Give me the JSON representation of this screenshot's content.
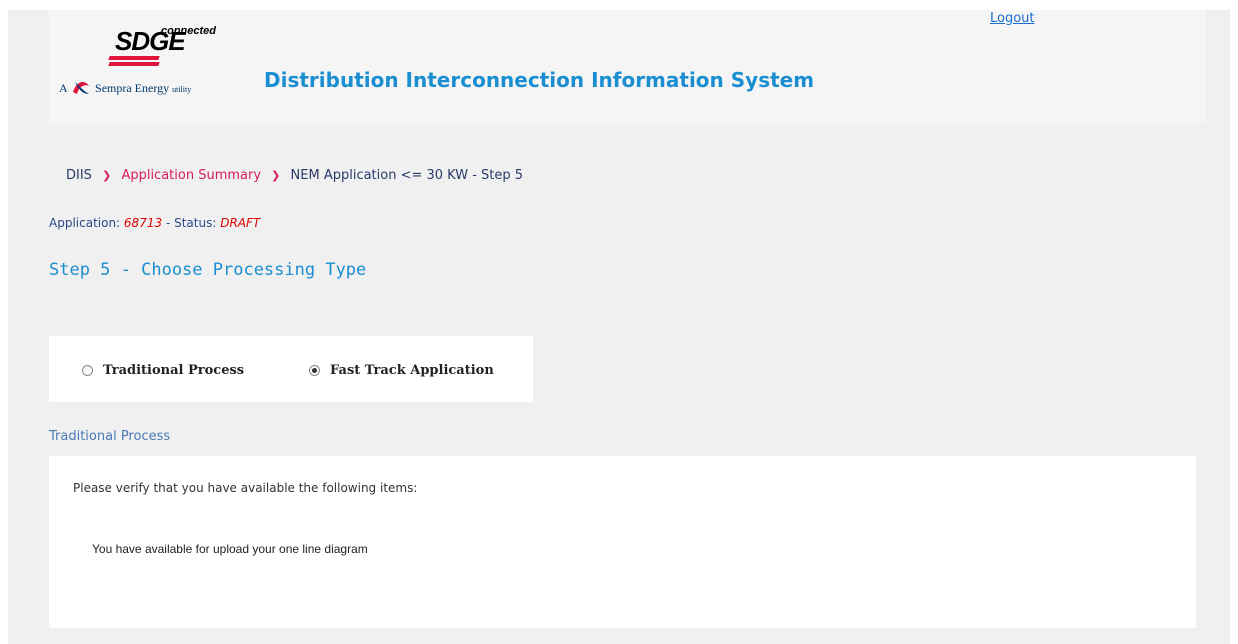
{
  "header": {
    "logo_sdge": "SDGE",
    "logo_connected": "connected",
    "logo_tagline_prefix": "A",
    "logo_tagline_company": "Sempra Energy",
    "logo_tagline_suffix": "utility",
    "app_title": "Distribution Interconnection Information System",
    "logout_label": "Logout"
  },
  "breadcrumb": {
    "items": [
      "DIIS",
      "Application Summary",
      "NEM Application <= 30 KW - Step 5"
    ],
    "separator": "❯"
  },
  "application": {
    "label": "Application:",
    "id": "68713",
    "status_label": "- Status:",
    "status": "DRAFT"
  },
  "step_title": "Step 5 - Choose Processing Type",
  "processing_options": [
    {
      "label": "Traditional Process",
      "selected": false
    },
    {
      "label": "Fast Track Application",
      "selected": true
    }
  ],
  "section": {
    "title": "Traditional Process",
    "verify_text": "Please verify that you have available the following items:",
    "items": [
      "You have available for upload your one line diagram"
    ]
  },
  "colors": {
    "title_blue": "#1a8ed1",
    "breadcrumb_accent": "#d81b60",
    "status_red": "#e00000",
    "logo_red": "#e0143c"
  }
}
